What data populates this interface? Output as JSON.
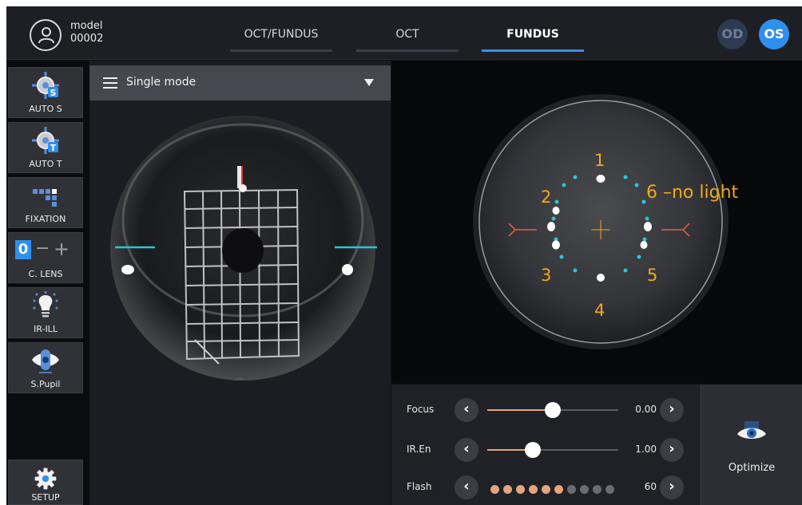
{
  "header": {
    "user_name": "model",
    "user_id": "00002",
    "tabs": [
      {
        "label": "OCT/FUNDUS",
        "active": false
      },
      {
        "label": "OCT",
        "active": false
      },
      {
        "label": "FUNDUS",
        "active": true
      }
    ],
    "eye_buttons": {
      "od": "OD",
      "os": "OS",
      "selected": "OS"
    }
  },
  "tools": [
    {
      "label": "AUTO S",
      "icon": "auto-s-target-icon"
    },
    {
      "label": "AUTO T",
      "icon": "auto-t-target-icon"
    },
    {
      "label": "FIXATION",
      "icon": "fixation-grid-icon"
    },
    {
      "label": "C. LENS",
      "icon": "lens-value-icon",
      "value": "0",
      "minus": "−",
      "plus": "+"
    },
    {
      "label": "IR-ILL",
      "icon": "lightbulb-icon"
    },
    {
      "label": "S.Pupil",
      "icon": "small-pupil-eye-icon"
    },
    {
      "label": "SETUP",
      "icon": "gear-icon"
    }
  ],
  "mode": {
    "label": "Single mode"
  },
  "fundus_annotations": {
    "point_1": "1",
    "point_2": "2",
    "point_3": "3",
    "point_4": "4",
    "point_5": "5",
    "point_6": "6 –no light"
  },
  "controls": {
    "focus": {
      "label": "Focus",
      "value": "0.00",
      "level": 0.5
    },
    "ir_en": {
      "label": "IR.En",
      "value": "1.00",
      "level": 0.35
    },
    "flash": {
      "label": "Flash",
      "value": "60",
      "on_dots": 6,
      "total_dots": 10
    }
  },
  "optimize": {
    "label": "Optimize"
  },
  "colors": {
    "accent": "#2f8fee",
    "slider_fill": "#e4a480",
    "cyan_marker": "#28c6d6",
    "annotation": "#f2a71b",
    "arrow": "#e5653a"
  }
}
